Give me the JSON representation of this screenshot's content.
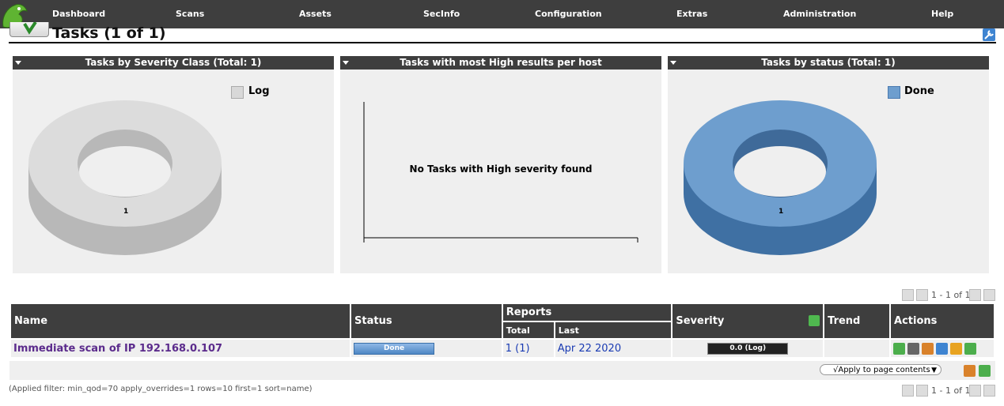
{
  "nav": {
    "items": [
      "Dashboard",
      "Scans",
      "Assets",
      "SecInfo",
      "Configuration",
      "Extras",
      "Administration",
      "Help"
    ]
  },
  "page": {
    "title": "Tasks (1 of 1)"
  },
  "panels": [
    {
      "title": "Tasks by Severity Class (Total: 1)",
      "legend": "Log",
      "legend_color": "#d8d8d8",
      "slice_label": "1"
    },
    {
      "title": "Tasks with most High results per host",
      "message": "No Tasks with High severity found"
    },
    {
      "title": "Tasks by status (Total: 1)",
      "legend": "Done",
      "legend_color": "#6e9ece",
      "slice_label": "1"
    }
  ],
  "pagination": {
    "text": "1 - 1 of 1"
  },
  "table": {
    "headers": {
      "name": "Name",
      "status": "Status",
      "reports": "Reports",
      "total": "Total",
      "last": "Last",
      "severity": "Severity",
      "trend": "Trend",
      "actions": "Actions"
    },
    "rows": [
      {
        "name": "Immediate scan of IP 192.168.0.107",
        "status": "Done",
        "reports_total": "1 (1)",
        "reports_last": "Apr 22 2020",
        "severity": "0.0 (Log)",
        "trend": ""
      }
    ]
  },
  "bulk": {
    "select_label": "√Apply to page contents"
  },
  "filter": {
    "applied": "(Applied filter: min_qod=70 apply_overrides=1 rows=10 first=1 sort=name)"
  },
  "colors": {
    "nav_bg": "#3e3e3e",
    "panel_bg": "#efefef",
    "done_blue": "#6e9ece",
    "log_grey": "#d8d8d8",
    "link": "#1a3bb3",
    "task_name": "#5b2b8c"
  }
}
